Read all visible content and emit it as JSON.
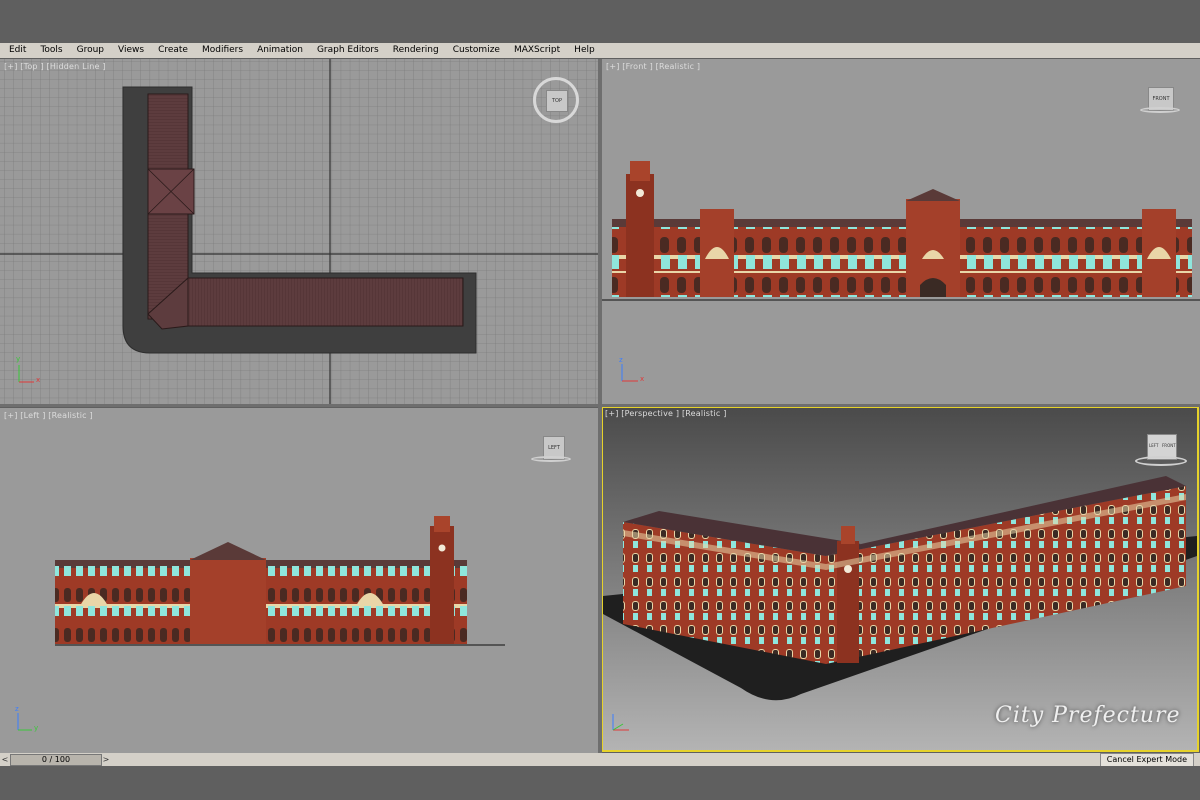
{
  "menu": [
    "Edit",
    "Tools",
    "Group",
    "Views",
    "Create",
    "Modifiers",
    "Animation",
    "Graph Editors",
    "Rendering",
    "Customize",
    "MAXScript",
    "Help"
  ],
  "viewports": {
    "top": {
      "label": "[+] [Top ] [Hidden Line ]",
      "cube": "TOP"
    },
    "front": {
      "label": "[+] [Front ] [Realistic ]",
      "cube": "FRONT"
    },
    "left": {
      "label": "[+] [Left ] [Realistic ]",
      "cube": "LEFT"
    },
    "perspective": {
      "label": "[+] [Perspective ] [Realistic ]",
      "cube_left": "LEFT",
      "cube_front": "FRONT"
    }
  },
  "axes": {
    "x": "x",
    "y": "y",
    "z": "z"
  },
  "timeline": {
    "frame": "0 / 100",
    "prev": "<",
    "next": ">"
  },
  "status": {
    "expert_mode": "Cancel Expert Mode"
  },
  "watermark": "City Prefecture",
  "colors": {
    "brick": "#9e3a26",
    "trim": "#e9d6a8",
    "roof": "#5a3a38",
    "window": "#8fe6dc",
    "active_border": "#e6d22a"
  }
}
